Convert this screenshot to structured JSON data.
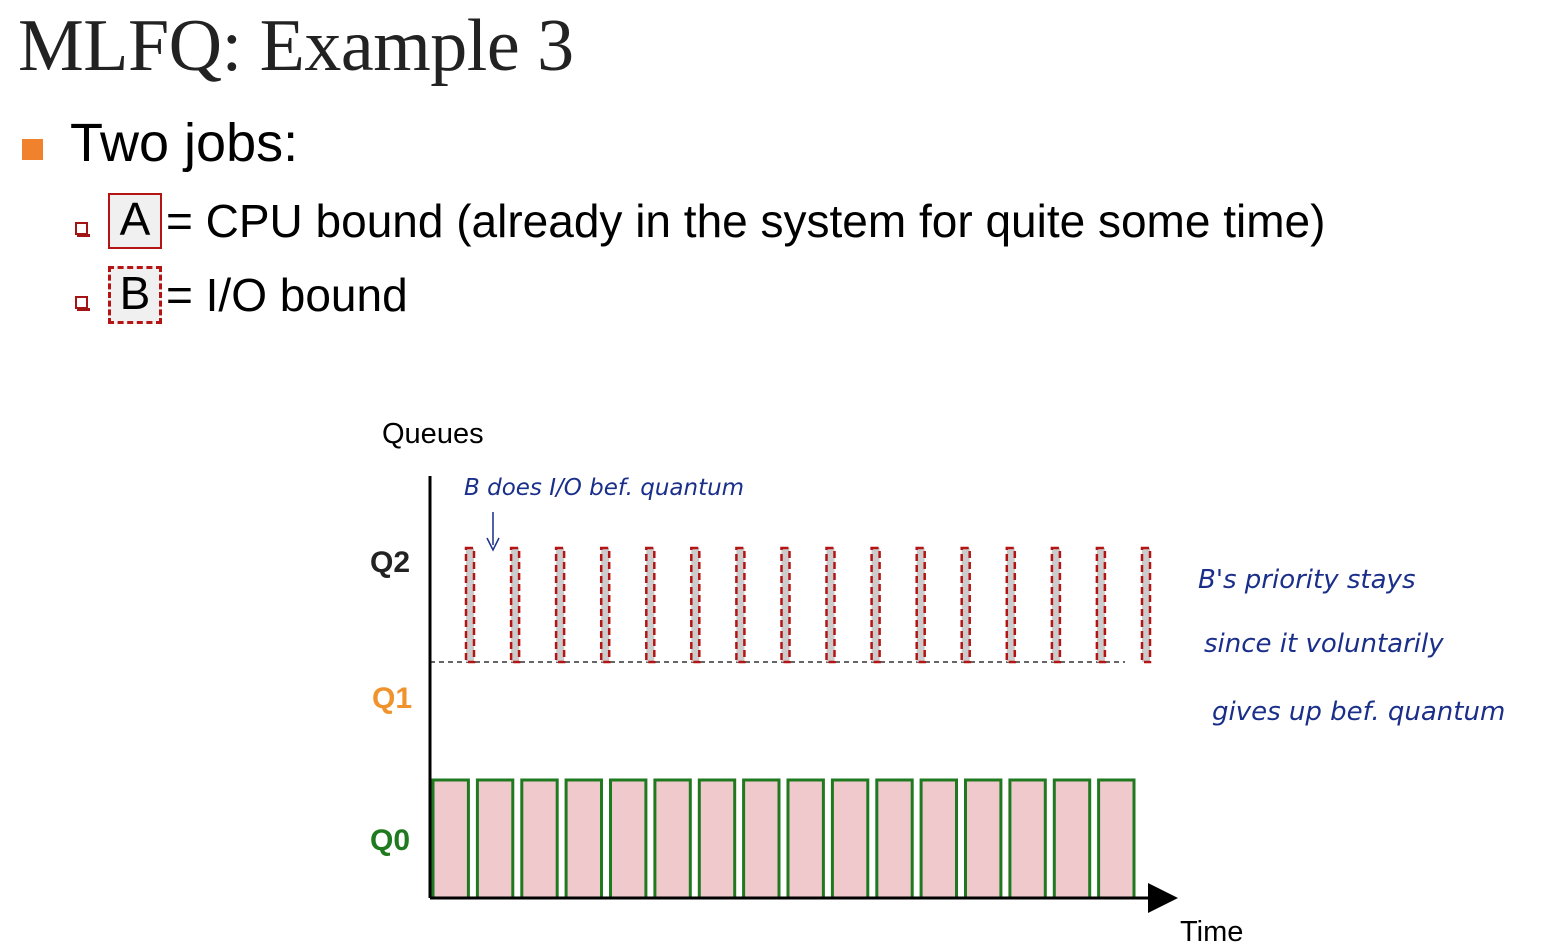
{
  "title": "MLFQ: Example 3",
  "bullet_main": "Two jobs:",
  "jobs": [
    {
      "box": "A",
      "desc": "= CPU bound (already in the system for quite some time)"
    },
    {
      "box": "B",
      "desc": "= I/O bound"
    }
  ],
  "diagram": {
    "y_axis_label": "Queues",
    "x_axis_label": "Time",
    "queues": [
      {
        "label": "Q2",
        "color": "#222222"
      },
      {
        "label": "Q1",
        "color": "#f0932d"
      },
      {
        "label": "Q0",
        "color": "#1f7a1f"
      }
    ],
    "job_a_slices": 16,
    "job_b_slices": 16,
    "job_a_color": {
      "stroke": "#1f7a1f",
      "fill": "#efc9cc"
    },
    "job_b_color": {
      "stroke": "#b41414",
      "fill": "#cccccc"
    },
    "annotation_top": "B does I/O bef. quantum",
    "annotation_right": [
      "B's priority stays",
      "since it voluntarily",
      "gives up bef. quantum"
    ],
    "annotation_color": "#1a2f8a"
  }
}
